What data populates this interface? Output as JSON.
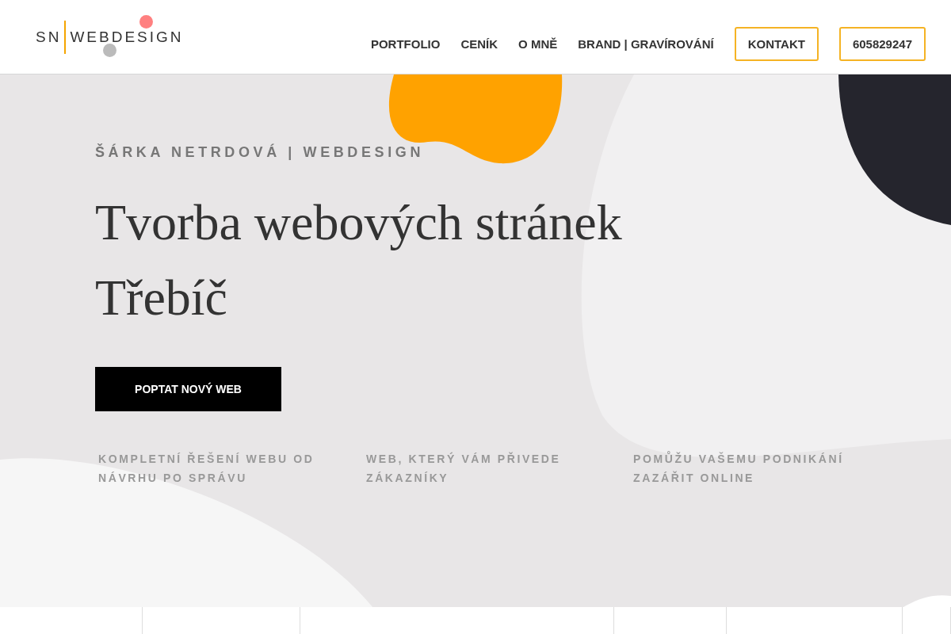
{
  "logo": {
    "initials": "SN",
    "name": "WEBDESIGN"
  },
  "nav": [
    {
      "label": "PORTFOLIO",
      "kind": "link"
    },
    {
      "label": "CENÍK",
      "kind": "link"
    },
    {
      "label": "O MNĚ",
      "kind": "link"
    },
    {
      "label": "BRAND | GRAVÍROVÁNÍ",
      "kind": "link"
    },
    {
      "label": "KONTAKT",
      "kind": "outlined"
    },
    {
      "label": "605829247",
      "kind": "outlined"
    }
  ],
  "hero": {
    "eyebrow": "ŠÁRKA NETRDOVÁ | WEBDESIGN",
    "title_lines": [
      "Tvorba webových stránek",
      "Třebíč"
    ],
    "cta": "POPTAT NOVÝ WEB",
    "features": [
      "KOMPLETNÍ ŘEŠENÍ WEBU OD NÁVRHU PO SPRÁVU",
      "WEB, KTERÝ VÁM PŘIVEDE ZÁKAZNÍKY",
      "POMŮŽU VAŠEMU PODNIKÁNÍ ZAZÁŘIT ONLINE"
    ]
  }
}
